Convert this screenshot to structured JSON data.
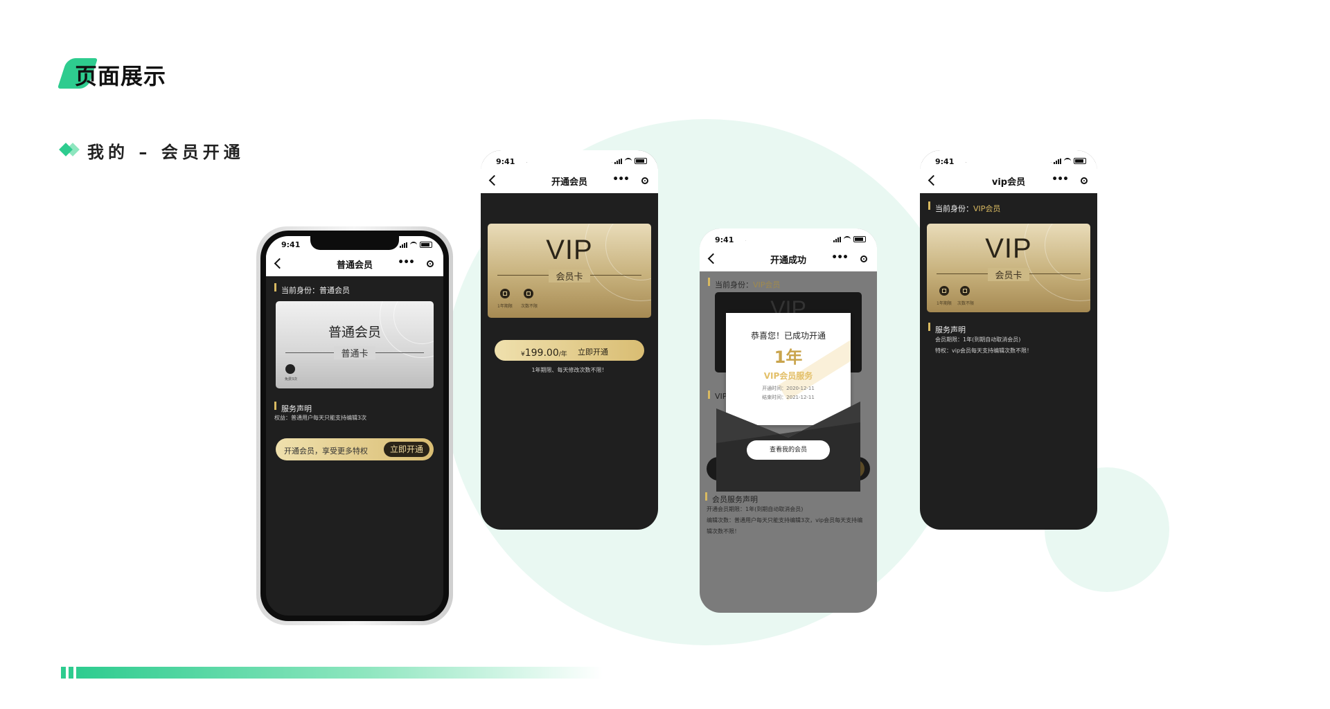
{
  "page": {
    "title": "页面展示",
    "section_title": "我的 – 会员开通"
  },
  "colors": {
    "accent": "#2ecc8f",
    "gold": "#d8b961",
    "dark_bg": "#1f1f1f"
  },
  "status_bar": {
    "time": "9:41"
  },
  "phone1": {
    "nav_title": "普通会员",
    "identity_label": "当前身份：普通会员",
    "card_title": "普通会员",
    "card_subtitle": "普通卡",
    "card_icon_label": "免费3次",
    "service_heading": "服务声明",
    "service_text": "权益：普通用户每天只能支持编辑3次",
    "cta_text": "开通会员，享受更多特权",
    "cta_button": "立即开通"
  },
  "phone2": {
    "nav_title": "开通会员",
    "card_vip": "VIP",
    "card_subtitle": "会员卡",
    "icon1_label": "1年期限",
    "icon2_label": "次数不限",
    "price_currency": "¥",
    "price_value": "199.00",
    "price_unit": "/年",
    "buy_button": "立即开通",
    "note": "1年期限、每天修改次数不限！"
  },
  "phone3": {
    "nav_title": "开通成功",
    "identity_label": "当前身份：",
    "identity_value": "VIP会员",
    "hidden_label": "VIP",
    "popup_title": "恭喜您！已成功开通",
    "popup_years": "1年",
    "popup_service": "VIP会员服务",
    "popup_start": "开通时间：2020-12-11",
    "popup_end": "结束时间：2021-12-11",
    "popup_button": "查看我的会员",
    "service_heading": "会员服务声明",
    "service_line1": "开通会员期限：1年(到期自动取消会员)",
    "service_line2": "编辑次数：普通用户每天只能支持编辑3次，vip会员每天支持编",
    "service_line3": "辑次数不限！"
  },
  "phone4": {
    "nav_title": "vip会员",
    "identity_label": "当前身份：",
    "identity_value": "VIP会员",
    "card_vip": "VIP",
    "card_subtitle": "会员卡",
    "icon1_label": "1年期限",
    "icon2_label": "次数不限",
    "service_heading": "服务声明",
    "service_line1": "会员期限：1年(到期自动取消会员)",
    "service_line2": "特权：vip会员每天支持编辑次数不限！"
  }
}
